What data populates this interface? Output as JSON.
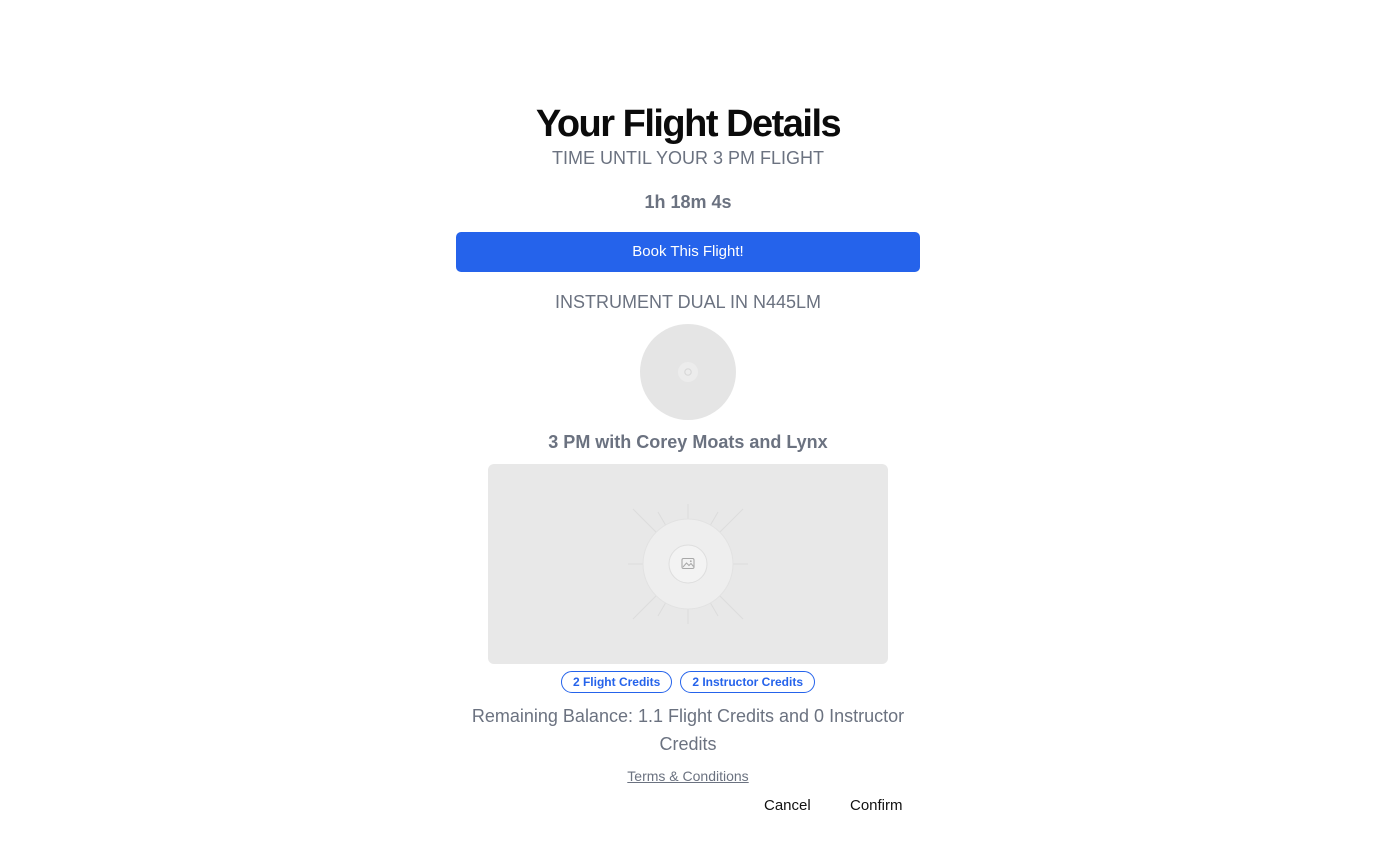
{
  "page": {
    "title": "Your Flight Details",
    "countdown_label": "TIME UNTIL YOUR 3 PM FLIGHT",
    "countdown_value": "1h 18m 4s"
  },
  "booking": {
    "book_button_label": "Book This Flight!",
    "lesson_type": "INSTRUMENT DUAL IN N445LM",
    "flight_info": "3 PM with Corey Moats and Lynx"
  },
  "credits": {
    "badges": [
      "2 Flight Credits",
      "2 Instructor Credits"
    ],
    "remaining_balance": "Remaining Balance: 1.1 Flight Credits and 0 Instructor Credits"
  },
  "footer": {
    "terms_link": "Terms & Conditions",
    "cancel_label": "Cancel",
    "confirm_label": "Confirm"
  },
  "icons": {
    "avatar": "user-avatar-placeholder-icon",
    "image": "image-placeholder-icon"
  },
  "colors": {
    "accent": "#2563eb",
    "muted_text": "#6b7280",
    "placeholder_bg": "#e8e8e8"
  }
}
